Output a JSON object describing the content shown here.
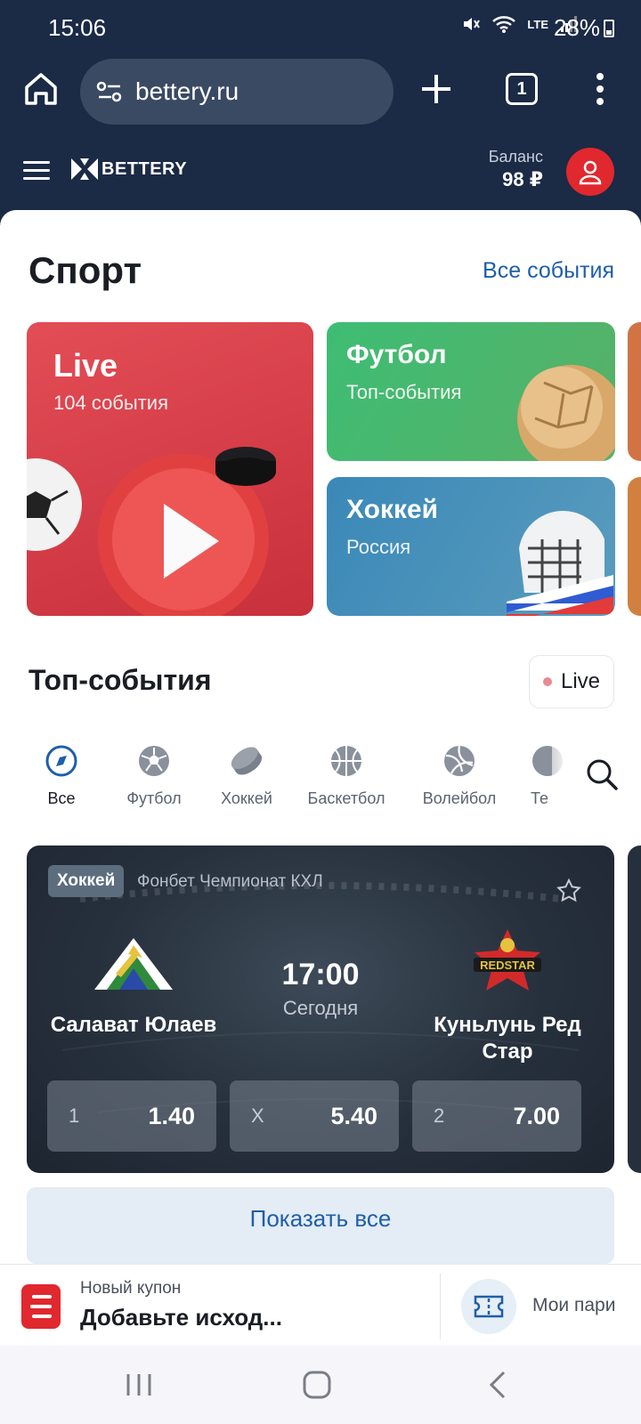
{
  "status": {
    "time": "15:06",
    "network": "LTE",
    "battery": "28%"
  },
  "browser": {
    "url": "bettery.ru",
    "tab_count": "1"
  },
  "header": {
    "logo_text": "BETTERY",
    "balance_label": "Баланс",
    "balance_value": "98 ₽"
  },
  "sport": {
    "title": "Спорт",
    "all_events": "Все события",
    "tiles": [
      {
        "title": "Live",
        "subtitle": "104 события",
        "color": "#d93a45"
      },
      {
        "title": "Футбол",
        "subtitle": "Топ-события",
        "color": "#48b86e"
      },
      {
        "title": "Хоккей",
        "subtitle": "Россия",
        "color": "#4a92bb"
      }
    ]
  },
  "top_events": {
    "title": "Топ-события",
    "live_chip": "Live",
    "filters": [
      {
        "label": "Все",
        "icon": "compass-icon",
        "active": true
      },
      {
        "label": "Футбол",
        "icon": "soccer-ball-icon"
      },
      {
        "label": "Хоккей",
        "icon": "hockey-puck-icon"
      },
      {
        "label": "Баскетбол",
        "icon": "basketball-icon"
      },
      {
        "label": "Волейбол",
        "icon": "volleyball-icon"
      },
      {
        "label": "Те",
        "icon": "tennis-icon"
      }
    ]
  },
  "event": {
    "sport": "Хоккей",
    "league": "Фонбет Чемпионат КХЛ",
    "home_team": "Салават Юлаев",
    "away_team_line1": "Куньлунь Ред",
    "away_team_line2": "Стар",
    "time": "17:00",
    "day": "Сегодня",
    "odds": [
      {
        "label": "1",
        "value": "1.40"
      },
      {
        "label": "X",
        "value": "5.40"
      },
      {
        "label": "2",
        "value": "7.00"
      }
    ]
  },
  "show_all": "Показать все",
  "coupon": {
    "label": "Новый купон",
    "value": "Добавьте исход...",
    "my_bets": "Мои пари"
  },
  "colors": {
    "brand_navy": "#1b2a45",
    "accent_red": "#e0282e",
    "link_blue": "#1f5fa8"
  }
}
